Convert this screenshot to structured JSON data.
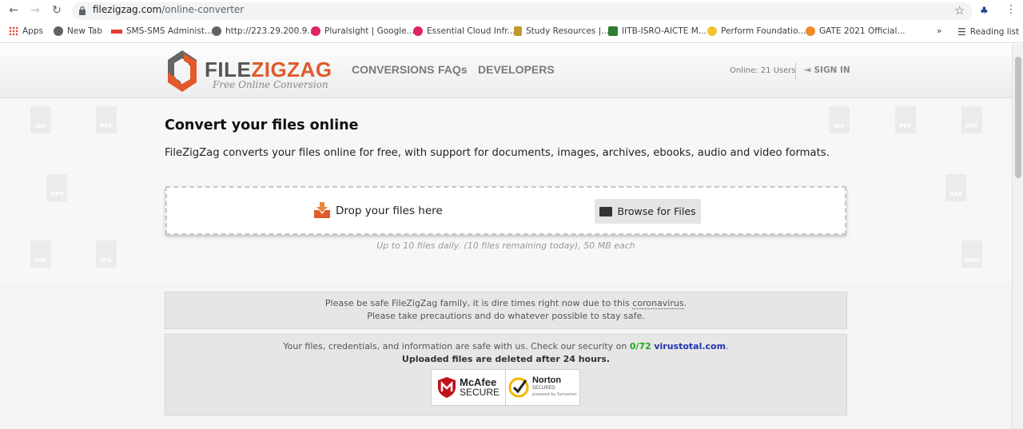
{
  "browser": {
    "url_host": "filezigzag.com",
    "url_path": "/online-converter",
    "bookmarks": [
      {
        "label": "Apps"
      },
      {
        "label": "New Tab"
      },
      {
        "label": "SMS-SMS Administ..."
      },
      {
        "label": "http://223.29.200.9..."
      },
      {
        "label": "Pluralsight | Google..."
      },
      {
        "label": "Essential Cloud Infr..."
      },
      {
        "label": "Study Resources |..."
      },
      {
        "label": "IITB-ISRO-AICTE M..."
      },
      {
        "label": "Perform Foundatio..."
      },
      {
        "label": "GATE 2021 Official..."
      }
    ],
    "overflow": "»",
    "reading_list": "Reading list"
  },
  "header": {
    "logo_file": "FILE",
    "logo_zigzag": "ZIGZAG",
    "tagline": "Free Online Conversion",
    "nav": [
      "CONVERSIONS",
      "FAQs",
      "DEVELOPERS"
    ],
    "online": "Online: 21 Users",
    "sign_in": "SIGN IN"
  },
  "hero": {
    "title": "Convert your files online",
    "lead": "FileZigZag converts your files online for free, with support for documents, images, archives, ebooks, audio and video formats.",
    "drop_text": "Drop your files here",
    "browse_label": "Browse for Files",
    "limit_text": "Up to 10 files daily. (10 files remaining today), 50 MB each",
    "bg_icons": [
      "GIF",
      "PPT",
      "PDF",
      "GIF",
      "PPT",
      "PDF",
      "GIF",
      "PPT",
      "PDF",
      "GIF",
      "PPT",
      "PDF",
      "GIF",
      "PPT",
      "PDF",
      "MP3",
      "RAR",
      "DOC",
      "JPG",
      "WMV"
    ]
  },
  "notice_corona": {
    "line1_a": "Please be safe FileZigZag family, it is dire times right now due to this ",
    "line1_link": "coronavirus",
    "line1_b": ".",
    "line2": "Please take precautions and do whatever possible to stay safe."
  },
  "notice_security": {
    "line1_a": "Your files, credentials, and information are safe with us. Check our security on ",
    "score": "0/72",
    "link": "virustotal.com",
    "line1_b": ".",
    "line2": "Uploaded files are deleted after 24 hours.",
    "mcafee_top": "McAfee",
    "mcafee_bottom": "SECURE",
    "norton_top": "Norton",
    "norton_bottom": "SECURED",
    "norton_sub": "powered by Symantec"
  },
  "colors": {
    "accent": "#e05a2b",
    "green": "#1ea91e",
    "link": "#2233aa"
  }
}
